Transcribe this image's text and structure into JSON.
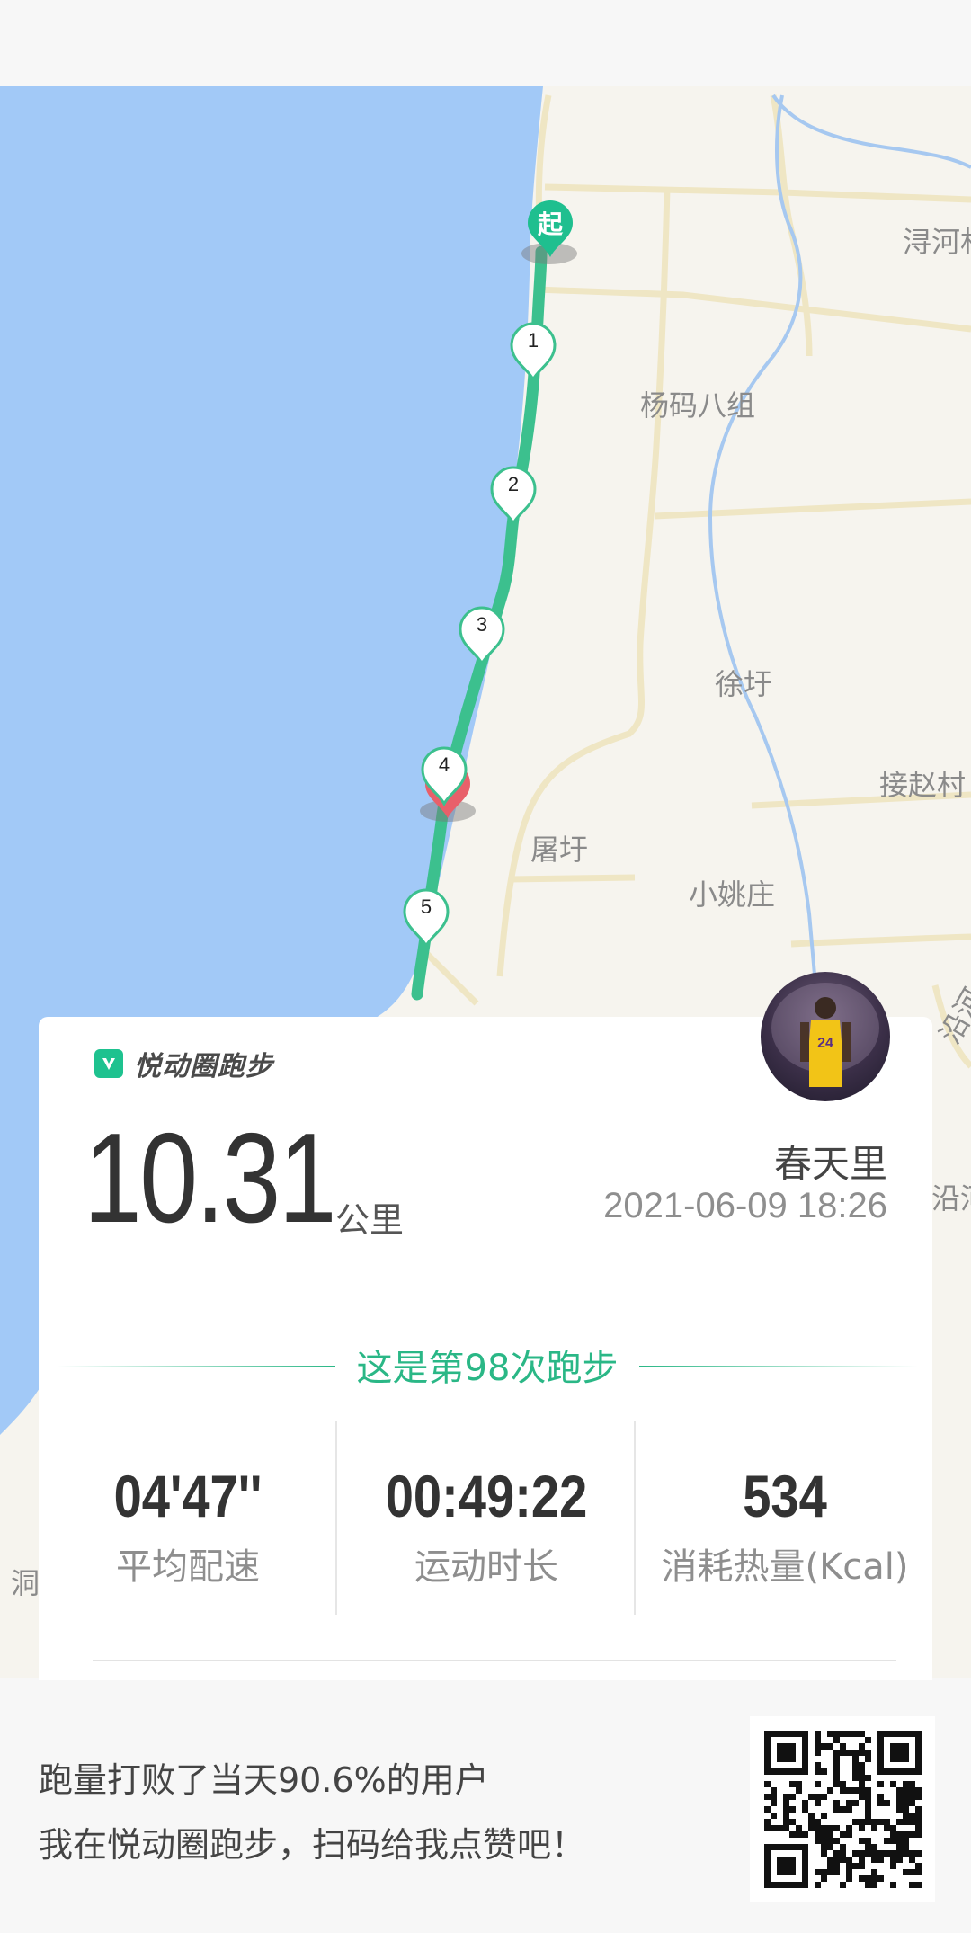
{
  "map": {
    "labels": [
      "浔河村",
      "杨码八组",
      "徐圩",
      "接赵村",
      "屠圩",
      "小姚庄",
      "沿河",
      "洞",
      "沿河"
    ],
    "route_color": "#3cc08e",
    "water_color": "#a2c9f7",
    "land_color": "#f6f4ee",
    "start_marker": "起",
    "km_markers": [
      "1",
      "2",
      "3",
      "4",
      "5"
    ]
  },
  "card": {
    "brand": "悦动圈跑步",
    "distance": "10.31",
    "distance_unit": "公里",
    "username": "春天里",
    "datetime": "2021-06-09 18:26",
    "run_count_text": "这是第98次跑步",
    "stats": [
      {
        "value": "04'47''",
        "label": "平均配速"
      },
      {
        "value": "00:49:22",
        "label": "运动时长"
      },
      {
        "value": "534",
        "label": "消耗热量(Kcal)"
      }
    ]
  },
  "footer": {
    "beat_text": "跑量打败了当天90.6%的用户",
    "share_text": "我在悦动圈跑步，扫码给我点赞吧！"
  },
  "colors": {
    "accent": "#2ab786",
    "end_marker": "#e8606a"
  }
}
